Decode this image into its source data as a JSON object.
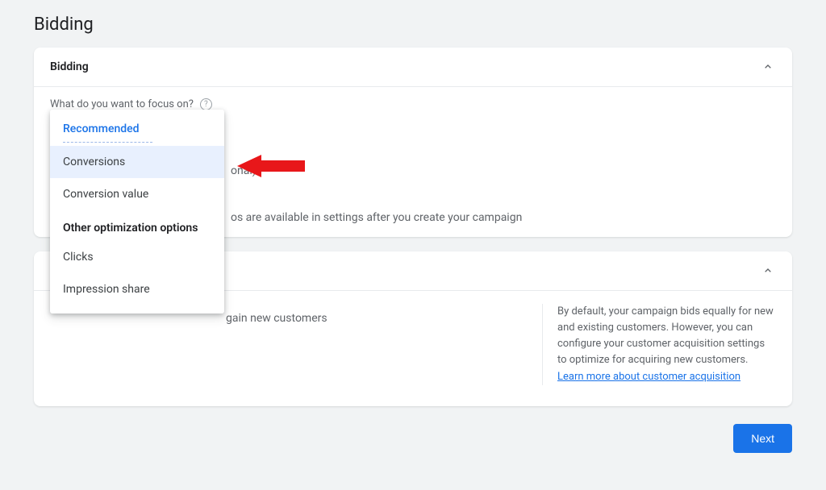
{
  "pageTitle": "Bidding",
  "biddingCard": {
    "title": "Bidding",
    "question": "What do you want to focus on?",
    "optionalFragment": "onal)",
    "settingsNote": "os are available in settings after you create your campaign"
  },
  "dropdown": {
    "recommendedHeader": "Recommended",
    "otherHeader": "Other optimization options",
    "items": {
      "conversions": "Conversions",
      "conversionValue": "Conversion value",
      "clicks": "Clicks",
      "impressionShare": "Impression share"
    }
  },
  "acquisitionCard": {
    "leftFragment": "gain new customers",
    "rightPrefix": "By default, your campaign bids equally for new and existing customers. However, you can configure your customer acquisition settings to optimize for acquiring new customers. ",
    "link": "Learn more about customer acquisition"
  },
  "footer": {
    "next": "Next"
  }
}
